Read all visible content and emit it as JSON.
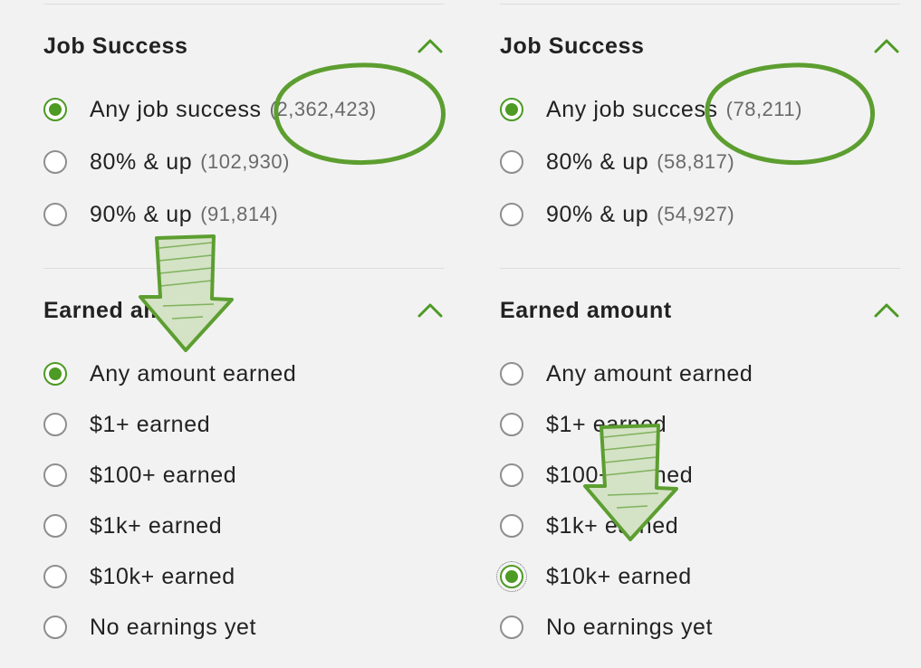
{
  "panels": [
    {
      "job_success": {
        "title": "Job Success",
        "options": [
          {
            "label": "Any job success",
            "count": "(2,362,423)",
            "checked": true
          },
          {
            "label": "80% & up",
            "count": "(102,930)",
            "checked": false
          },
          {
            "label": "90% & up",
            "count": "(91,814)",
            "checked": false
          }
        ]
      },
      "earned_amount": {
        "title": "Earned amount",
        "options": [
          {
            "label": "Any amount earned",
            "checked": true
          },
          {
            "label": "$1+ earned",
            "checked": false
          },
          {
            "label": "$100+ earned",
            "checked": false
          },
          {
            "label": "$1k+ earned",
            "checked": false
          },
          {
            "label": "$10k+ earned",
            "checked": false
          },
          {
            "label": "No earnings yet",
            "checked": false
          }
        ]
      }
    },
    {
      "job_success": {
        "title": "Job Success",
        "options": [
          {
            "label": "Any job success",
            "count": "(78,211)",
            "checked": true
          },
          {
            "label": "80% & up",
            "count": "(58,817)",
            "checked": false
          },
          {
            "label": "90% & up",
            "count": "(54,927)",
            "checked": false
          }
        ]
      },
      "earned_amount": {
        "title": "Earned amount",
        "options": [
          {
            "label": "Any amount earned",
            "checked": false
          },
          {
            "label": "$1+ earned",
            "checked": false
          },
          {
            "label": "$100+ earned",
            "checked": false
          },
          {
            "label": "$1k+ earned",
            "checked": false
          },
          {
            "label": "$10k+ earned",
            "checked": true
          },
          {
            "label": "No earnings yet",
            "checked": false
          }
        ]
      }
    }
  ],
  "colors": {
    "accent_green": "#4d9a24",
    "annotation_green": "#5c9e30",
    "annotation_fill": "#d4e2c5",
    "background": "#f2f2f2"
  },
  "icons": {
    "collapse": "chevron-up-icon",
    "annotation_arrow": "down-arrow-icon",
    "annotation_circle": "ellipse-highlight"
  }
}
